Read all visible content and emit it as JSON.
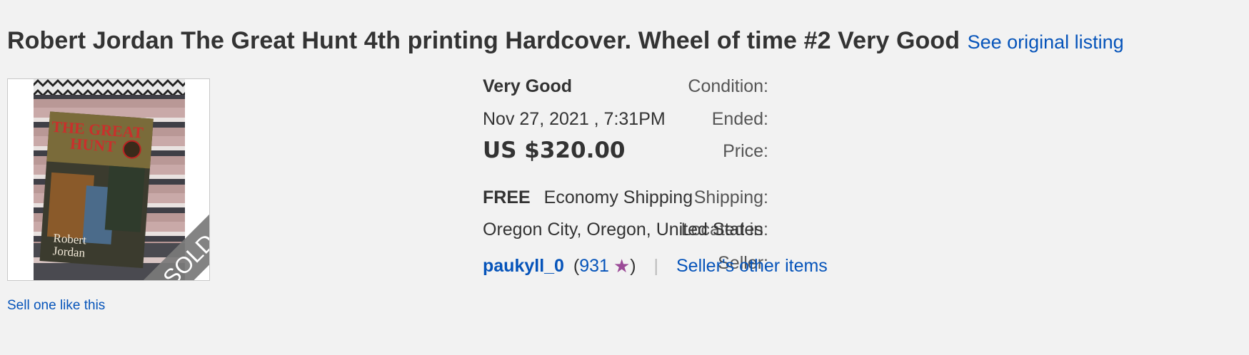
{
  "listing": {
    "title": "Robert Jordan The Great Hunt 4th printing Hardcover. Wheel of time #2 Very Good",
    "see_original": "See original listing",
    "sell_one": "Sell one like this",
    "image": {
      "sold_badge": "SOLD",
      "cover_title_line1": "THE GREAT",
      "cover_title_line2": "HUNT",
      "cover_author_line1": "Robert",
      "cover_author_line2": "Jordan"
    }
  },
  "details": {
    "condition": {
      "label": "Condition:",
      "value": "Very Good"
    },
    "ended": {
      "label": "Ended:",
      "value": "Nov 27, 2021 , 7:31PM"
    },
    "price": {
      "label": "Price:",
      "value": "US $320.00"
    },
    "shipping": {
      "label": "Shipping:",
      "free": "FREE",
      "method": "Economy Shipping"
    },
    "location": {
      "label": "Located in:",
      "value": "Oregon City, Oregon, United States"
    },
    "seller": {
      "label": "Seller:",
      "name": "paukyll_0",
      "open_paren": "(",
      "feedback": "931",
      "close_paren": ")",
      "separator": "|",
      "other_items": "Seller's other items",
      "star_icon": "purple-star-icon",
      "star_color": "#9b4a97"
    }
  },
  "colors": {
    "link": "#0654ba",
    "background": "#f2f2f2",
    "text": "#333333"
  }
}
